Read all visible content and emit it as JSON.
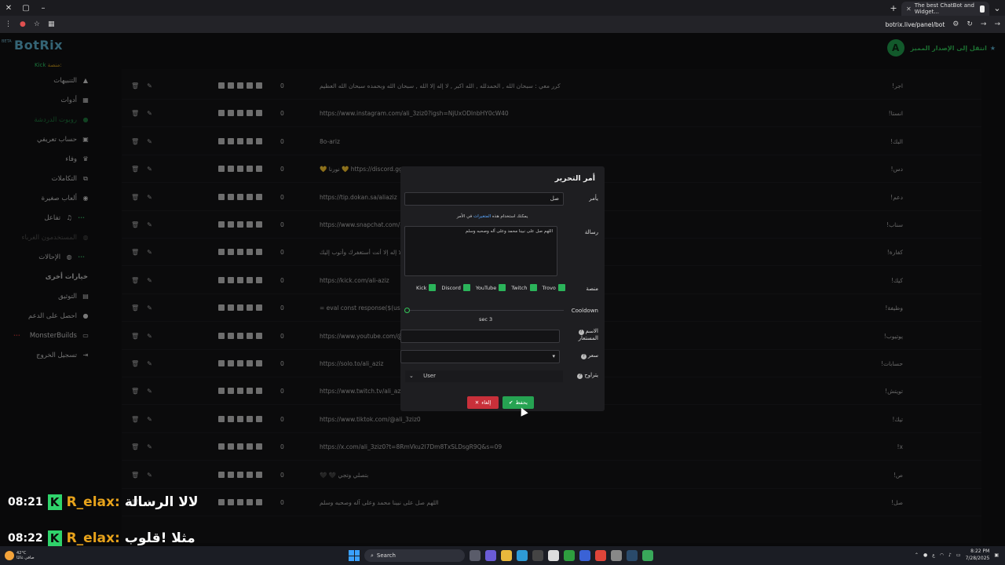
{
  "browser": {
    "tab_title": "The best ChatBot and Widget...",
    "url": "botrix.live/panel/bot"
  },
  "header": {
    "beta": "BETA",
    "brand": "BotRix",
    "platform_hint": "منصة:",
    "platform_value": "Kick",
    "upgrade_label": "انتقل إلى الإصدار المميز",
    "avatar_letter": "A"
  },
  "sidebar": {
    "items": [
      {
        "label": "التنبيهات",
        "icon": "alert-icon"
      },
      {
        "label": "أدوات",
        "icon": "tools-icon"
      },
      {
        "label": "روبوت الدردشة",
        "icon": "chatbot-icon",
        "active": true
      },
      {
        "label": "حساب تعريفي",
        "icon": "profile-icon"
      },
      {
        "label": "وفاء",
        "icon": "trophy-icon"
      },
      {
        "label": "التكاملات",
        "icon": "integrations-icon"
      },
      {
        "label": "ألعاب صغيرة",
        "icon": "games-icon"
      },
      {
        "label": "تفاعل",
        "icon": "music-icon",
        "badge": "•••"
      },
      {
        "label": "المستخدمون الغرباء",
        "icon": "users-icon",
        "dim": true
      },
      {
        "label": "الإحالات",
        "icon": "referrals-icon",
        "badge": "•••"
      }
    ],
    "section_title": "خيارات أخرى",
    "other_items": [
      {
        "label": "التوثيق",
        "icon": "docs-icon"
      },
      {
        "label": "احصل على الدعم",
        "icon": "support-icon"
      },
      {
        "label": "MonsterBuilds",
        "icon": "monitor-icon",
        "badge": "•••",
        "badge_red": true
      },
      {
        "label": "تسجيل الخروج",
        "icon": "logout-icon"
      }
    ]
  },
  "commands": {
    "rows": [
      {
        "cmd": "!اجر",
        "uses": "0",
        "msg": "كرر معي : سبحان الله , الحمدلله , الله اكبر , لا إله إلا الله , سبحان الله وبحمده سبحان الله العظيم"
      },
      {
        "cmd": "!انستا",
        "uses": "0",
        "msg": "https://www.instagram.com/ali_3ziz0?igsh=NjUxODlnbHY0cW40"
      },
      {
        "cmd": "!البك",
        "uses": "0",
        "msg": "8o-ariz"
      },
      {
        "cmd": "!دس",
        "uses": "0",
        "msg": "💛 نورنا 💛 https://discord.gg/..."
      },
      {
        "cmd": "!دعم",
        "uses": "0",
        "msg": "https://tip.dokan.sa/aliaziz"
      },
      {
        "cmd": "!سناب",
        "uses": "0",
        "msg": "https://www.snapchat.com/add/...device_type=desktop&is_copy_url=true"
      },
      {
        "cmd": "!كفارة",
        "uses": "0",
        "msg": "سبحانك اللهم وبحمدك أشهد أن لا إله إلا أنت أستغفرك وأتوب إليك"
      },
      {
        "cmd": "!كيك",
        "uses": "0",
        "msg": "https://kick.com/ali-aziz"
      },
      {
        "cmd": "!وظيفة",
        "uses": "0",
        "msg": "= eval const response($(user)) ..."
      },
      {
        "cmd": "!يوتيوب",
        "uses": "0",
        "msg": "https://www.youtube.com/@ali_aziz"
      },
      {
        "cmd": "!حسابات",
        "uses": "0",
        "msg": "https://solo.to/ali_aziz"
      },
      {
        "cmd": "!تويتش",
        "uses": "0",
        "msg": "https://www.twitch.tv/ali_aziz"
      },
      {
        "cmd": "!تيك",
        "uses": "0",
        "msg": "https://www.tiktok.com/@ali_3ziz0"
      },
      {
        "cmd": "!x",
        "uses": "0",
        "msg": "https://x.com/ali_3ziz0?t=8RmVku2l7Dm8TxSLDsgR9Q&s=09"
      },
      {
        "cmd": "!ص",
        "uses": "0",
        "msg": "🖤 🖤 بتصلي وتجي"
      },
      {
        "cmd": "!صل",
        "uses": "0",
        "msg": "اللهم صل على نبينا محمد وعلى آله وصحبه وسلم"
      }
    ]
  },
  "modal": {
    "title": "أمر التحرير",
    "command_label": "يأمر",
    "command_value": "صل",
    "hint_prefix": "يمكنك استخدام هذه",
    "hint_link": "المتغيرات",
    "hint_suffix": "في الأمر",
    "message_label": "رسالة",
    "message_value": "اللهم صل على نبينا محمد وعلى آله وصحبه وسلم",
    "platform_label": "منصة",
    "platforms": [
      "Kick",
      "Discord",
      "YouTube",
      "Twitch",
      "Trovo"
    ],
    "cooldown_label": "Cooldown",
    "cooldown_value": "sec 3",
    "alias_label": "الاسم المستعار",
    "price_label": "سعر",
    "permission_label": "يتراوح",
    "permission_value": "User",
    "cancel_label": "إلغاء",
    "save_label": "يحفظ"
  },
  "stream_chat": [
    {
      "time": "08:21",
      "user": "R_elax:",
      "text": "لالا الرسالة"
    },
    {
      "time": "08:22",
      "user": "R_elax:",
      "text": "مثلا !قلوب"
    }
  ],
  "taskbar": {
    "temp": "42°C",
    "weather": "صافي غالبًا",
    "search": "Search",
    "lang": "ع",
    "time": "8:22 PM",
    "date": "7/28/2025"
  },
  "colors": {
    "accent": "#26a352",
    "danger": "#c8303a",
    "brand": "#5fb6d6"
  }
}
